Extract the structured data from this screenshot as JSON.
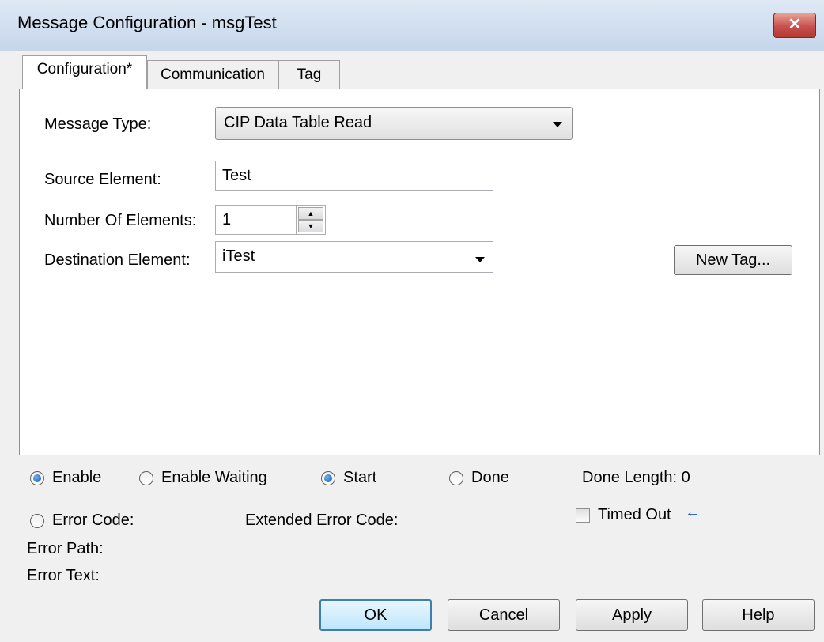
{
  "window": {
    "title": "Message Configuration - msgTest",
    "close_glyph": "✕"
  },
  "tabs": [
    {
      "label": "Configuration*",
      "active": true
    },
    {
      "label": "Communication",
      "active": false
    },
    {
      "label": "Tag",
      "active": false
    }
  ],
  "config": {
    "message_type_label": "Message Type:",
    "message_type_value": "CIP Data Table Read",
    "source_element_label": "Source Element:",
    "source_element_value": "Test",
    "num_elements_label": "Number Of Elements:",
    "num_elements_value": "1",
    "destination_element_label": "Destination Element:",
    "destination_element_value": "iTest",
    "new_tag_button": "New Tag..."
  },
  "status": {
    "enable": {
      "label": "Enable",
      "checked": true
    },
    "enable_waiting": {
      "label": "Enable Waiting",
      "checked": false
    },
    "start": {
      "label": "Start",
      "checked": true
    },
    "done": {
      "label": "Done",
      "checked": false
    },
    "done_length": "Done Length: 0",
    "error_code": {
      "label": "Error Code:",
      "checked": false
    },
    "extended_error_code": "Extended Error Code:",
    "timed_out": {
      "label": "Timed Out",
      "checked": false
    },
    "error_path": "Error Path:",
    "error_text": "Error Text:"
  },
  "buttons": {
    "ok": "OK",
    "cancel": "Cancel",
    "apply": "Apply",
    "help": "Help"
  },
  "icons": {
    "close": "close-icon",
    "dropdown": "chevron-down-icon",
    "spinner": "spinner-icon",
    "timed_out_indicator": "arrow-left-icon"
  },
  "colors": {
    "title_bar": "#c5d6ea",
    "close_button": "#c75050",
    "default_button_border": "#3c7fb1",
    "radio_selected": "#14509c",
    "indicator_arrow": "#1b56c8"
  }
}
